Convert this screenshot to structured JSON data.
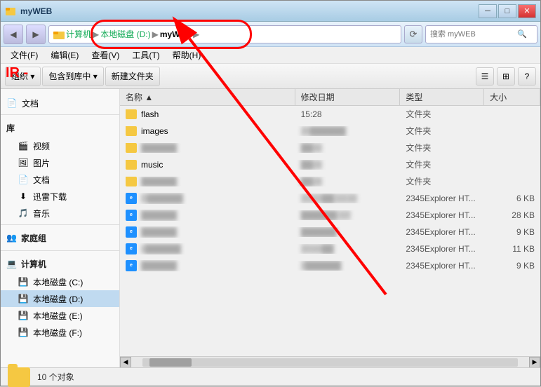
{
  "window": {
    "title": "myWEB",
    "title_controls": {
      "minimize": "─",
      "maximize": "□",
      "close": "✕"
    }
  },
  "address_bar": {
    "back_btn": "◀",
    "forward_btn": "▶",
    "breadcrumb": [
      {
        "label": "计算机",
        "active": false
      },
      {
        "label": "本地磁盘 (D:)",
        "active": false
      },
      {
        "label": "myWEB",
        "active": true
      }
    ],
    "refresh": "⟳",
    "search_placeholder": "搜索 myWEB",
    "search_icon": "🔍"
  },
  "menu": {
    "items": [
      "文件(F)",
      "编辑(E)",
      "查看(V)",
      "工具(T)",
      "帮助(H)"
    ]
  },
  "toolbar": {
    "organize_label": "组织 ▾",
    "include_label": "包含到库中 ▾",
    "new_folder_label": "新建文件夹",
    "view_icon": "☰",
    "view2_icon": "⊞",
    "help_icon": "?"
  },
  "sidebar": {
    "favorites": {
      "header": "文档",
      "icon": "📄"
    },
    "sections": [
      {
        "header": "库",
        "items": [
          {
            "label": "视频",
            "icon": "🎬"
          },
          {
            "label": "图片",
            "icon": "🖼"
          },
          {
            "label": "文档",
            "icon": "📄"
          },
          {
            "label": "迅雷下载",
            "icon": "⬇"
          },
          {
            "label": "音乐",
            "icon": "🎵"
          }
        ]
      },
      {
        "header": "家庭组",
        "items": []
      },
      {
        "header": "计算机",
        "items": [
          {
            "label": "本地磁盘 (C:)",
            "icon": "💾"
          },
          {
            "label": "本地磁盘 (D:)",
            "icon": "💾",
            "selected": true
          },
          {
            "label": "本地磁盘 (E:)",
            "icon": "💾"
          },
          {
            "label": "本地磁盘 (F:)",
            "icon": "💾"
          }
        ]
      }
    ]
  },
  "file_list": {
    "columns": [
      "名称",
      "修改日期",
      "类型",
      "大小"
    ],
    "files": [
      {
        "name": "flash",
        "date": "15:28",
        "type": "文件夹",
        "size": "",
        "kind": "folder"
      },
      {
        "name": "images",
        "date": "20",
        "type": "文件夹",
        "size": "",
        "kind": "folder"
      },
      {
        "name": "██████",
        "date": "30",
        "type": "文件夹",
        "size": "",
        "kind": "folder",
        "blurred": true
      },
      {
        "name": "music",
        "date": "28",
        "type": "文件夹",
        "size": "",
        "kind": "folder"
      },
      {
        "name": "██████",
        "date": "28",
        "type": "文件夹",
        "size": "",
        "kind": "folder",
        "blurred": true
      },
      {
        "name": "D██████",
        "date": "2016/██ 10:30",
        "type": "2345Explorer HT...",
        "size": "6 KB",
        "kind": "html",
        "blurred": true
      },
      {
        "name": "██████",
        "date": "██████ :07",
        "type": "2345Explorer HT...",
        "size": "28 KB",
        "kind": "html",
        "blurred": true
      },
      {
        "name": "██████",
        "date": "██████",
        "type": "2345Explorer HT...",
        "size": "9 KB",
        "kind": "html",
        "blurred": true
      },
      {
        "name": "v██████",
        "date": "2016/██",
        "type": "2345Explorer HT...",
        "size": "11 KB",
        "kind": "html",
        "blurred": true
      },
      {
        "name": "██████",
        "date": "2██████",
        "type": "2345Explorer HT...",
        "size": "9 KB",
        "kind": "html",
        "blurred": true
      }
    ]
  },
  "status_bar": {
    "count_text": "10 个对象"
  },
  "annotation": {
    "arrow_text": "IR -"
  }
}
